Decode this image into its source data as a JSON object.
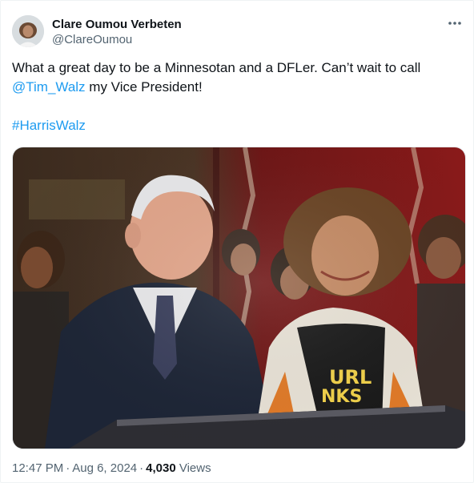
{
  "author": {
    "display_name": "Clare Oumou Verbeten",
    "handle": "@ClareOumou"
  },
  "tweet": {
    "text_before": "What a great day to be a Minnesotan and a DFLer. Can’t wait to call",
    "mention": "@Tim_Walz",
    "text_after": " my Vice President!",
    "hashtag": "#HarrisWalz"
  },
  "meta": {
    "time": "12:47 PM",
    "separator": "·",
    "date": "Aug 6, 2024",
    "views_count": "4,030",
    "views_label": "Views"
  },
  "icons": {
    "more": "more-horizontal-icon",
    "avatar": "profile-avatar"
  },
  "colors": {
    "link": "#1d9bf0",
    "text": "#0f1419",
    "secondary": "#536471"
  }
}
